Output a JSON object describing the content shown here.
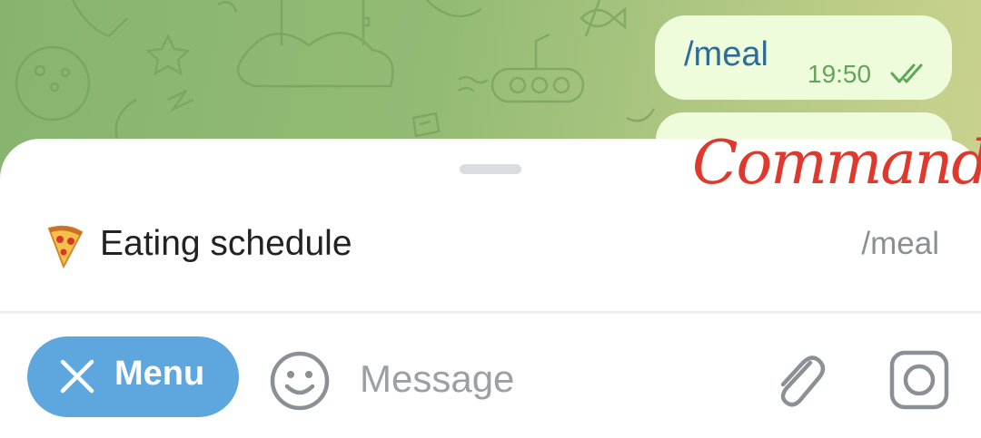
{
  "chat": {
    "messages": [
      {
        "text": "/meal",
        "time": "19:50",
        "status": "read"
      }
    ]
  },
  "annotation": {
    "text": "Command",
    "color": "#e0382c"
  },
  "command_list": {
    "items": [
      {
        "icon": "pizza-icon",
        "description": "Eating schedule",
        "command": "/meal"
      }
    ]
  },
  "input_bar": {
    "menu_label": "Menu",
    "message_placeholder": "Message",
    "menu_color": "#5ea6de"
  }
}
